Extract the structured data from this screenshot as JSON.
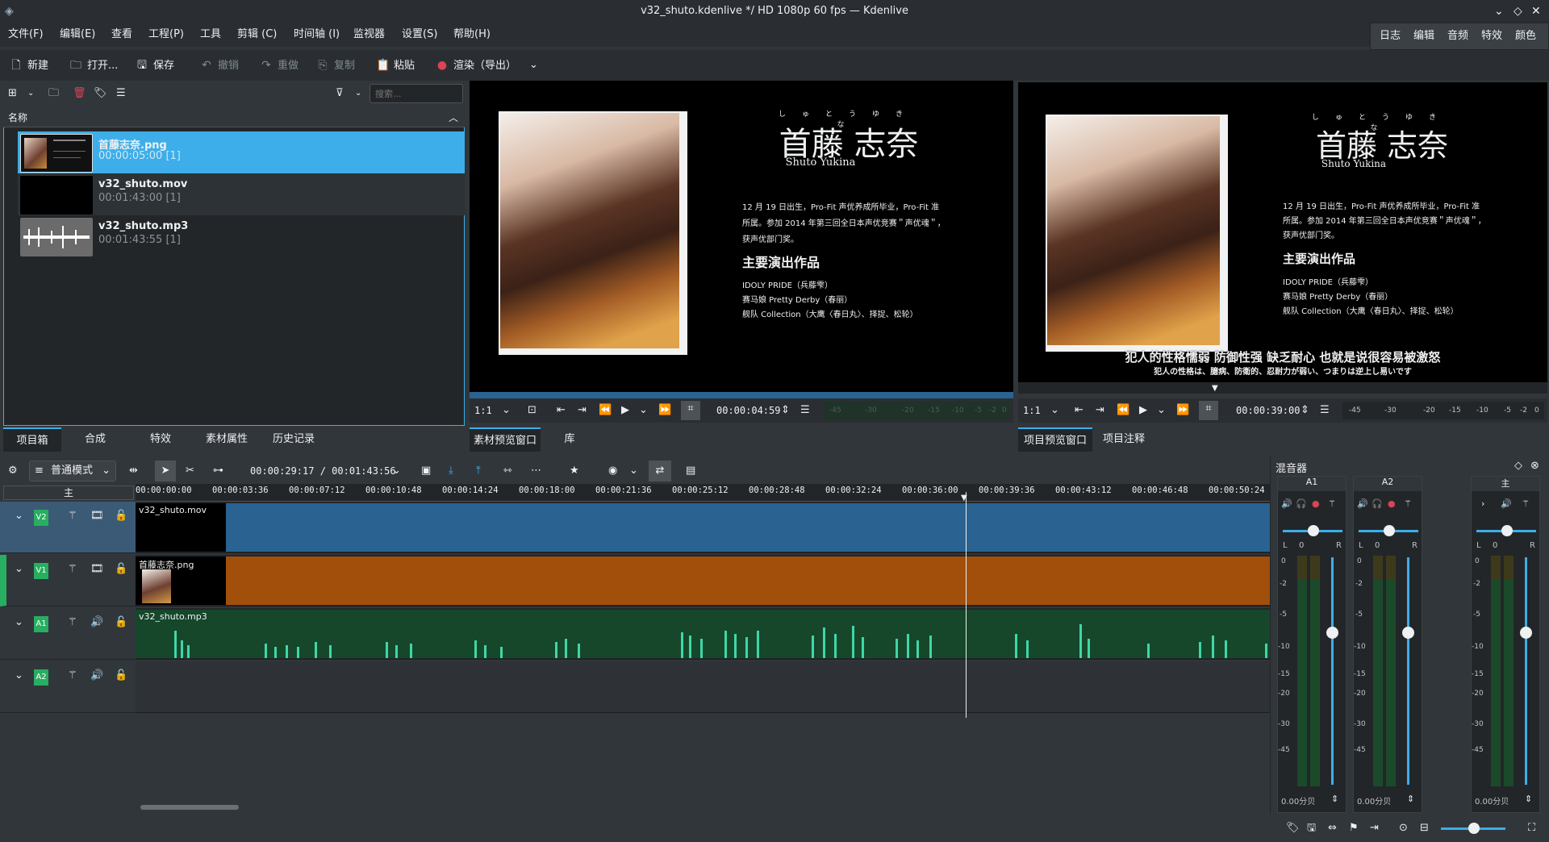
{
  "window": {
    "title": "v32_shuto.kdenlive */ HD 1080p 60 fps — Kdenlive"
  },
  "menu": [
    "文件(F)",
    "编辑(E)",
    "查看",
    "工程(P)",
    "工具",
    "剪辑 (C)",
    "时间轴 (I)",
    "监视器",
    "设置(S)",
    "帮助(H)"
  ],
  "workspaces": [
    "日志",
    "编辑",
    "音频",
    "特效",
    "颜色"
  ],
  "toolbar": {
    "new": "新建",
    "open": "打开...",
    "save": "保存",
    "undo": "撤销",
    "redo": "重做",
    "copy": "复制",
    "paste": "粘贴",
    "render": "渲染（导出）"
  },
  "bin": {
    "search_placeholder": "搜索...",
    "column": "名称",
    "clips": [
      {
        "name": "首藤志奈.png",
        "duration": "00:00:05:00 [1]"
      },
      {
        "name": "v32_shuto.mov",
        "duration": "00:01:43:00 [1]"
      },
      {
        "name": "v32_shuto.mp3",
        "duration": "00:01:43:55 [1]"
      }
    ]
  },
  "bin_tabs": [
    "项目箱",
    "合成",
    "特效",
    "素材属性",
    "历史记录"
  ],
  "clip_monitor": {
    "zoom": "1:1",
    "timecode": "00:00:04:59",
    "tabs": [
      "素材预览窗口",
      "库"
    ]
  },
  "project_monitor": {
    "zoom": "1:1",
    "timecode": "00:00:39:00",
    "tabs": [
      "项目预览窗口",
      "项目注释"
    ]
  },
  "profile": {
    "name_ruby": [
      "しゅ",
      "とう",
      "ゆき",
      "な"
    ],
    "name": "首藤 志奈",
    "romaji": "Shuto Yukina",
    "bio": [
      "12 月 19 日出生，Pro-Fit 声优养成所毕业，Pro-Fit 准",
      "所属。参加 2014 年第三回全日本声优竞赛＂声优魂＂，",
      "获声优部门奖。"
    ],
    "works_title": "主要演出作品",
    "works": [
      "IDOLY PRIDE（兵藤雫）",
      "赛马娘 Pretty Derby（春丽）",
      "舰队 Collection（大鹰〈春日丸〉、择捉、松轮）"
    ],
    "subtitle_cn": "犯人的性格懦弱 防御性强 缺乏耐心 也就是说很容易被激怒",
    "subtitle_jp": "犯人の性格は、臆病、防衛的、忍耐力が弱い、つまりは逆上し易いです"
  },
  "timeline": {
    "mode": "普通模式",
    "position": "00:00:29:17 / 00:01:43:56",
    "master": "主",
    "ruler": [
      "00:00:00:00",
      "00:00:03:36",
      "00:00:07:12",
      "00:00:10:48",
      "00:00:14:24",
      "00:00:18:00",
      "00:00:21:36",
      "00:00:25:12",
      "00:00:28:48",
      "00:00:32:24",
      "00:00:36:00",
      "00:00:39:36",
      "00:00:43:12",
      "00:00:46:48",
      "00:00:50:24"
    ],
    "tracks": [
      {
        "id": "V2",
        "clip": "v32_shuto.mov"
      },
      {
        "id": "V1",
        "clip": "首藤志奈.png"
      },
      {
        "id": "A1",
        "clip": "v32_shuto.mp3"
      },
      {
        "id": "A2",
        "clip": ""
      }
    ]
  },
  "mixer": {
    "title": "混音器",
    "strips": [
      {
        "name": "A1",
        "pan": "0",
        "level": "0.00分贝"
      },
      {
        "name": "A2",
        "pan": "0",
        "level": "0.00分贝"
      },
      {
        "name": "主",
        "pan": "0",
        "level": "0.00分贝"
      }
    ],
    "db_scale": [
      "0",
      "-2",
      "-5",
      "-10",
      "-15",
      "-20",
      "-30",
      "-45"
    ],
    "lr": [
      "L",
      "R"
    ]
  },
  "vu_scale": [
    "-45",
    "-30",
    "-20",
    "-15",
    "-10",
    "-5",
    "-2",
    "0"
  ],
  "colors": {
    "accent": "#3daee9",
    "v2clip": "#2a6391",
    "v1clip": "#a14f0a",
    "audio": "#16472b",
    "wave": "#3ed7a8",
    "track_tag": "#27ae60",
    "record": "#da4453"
  }
}
